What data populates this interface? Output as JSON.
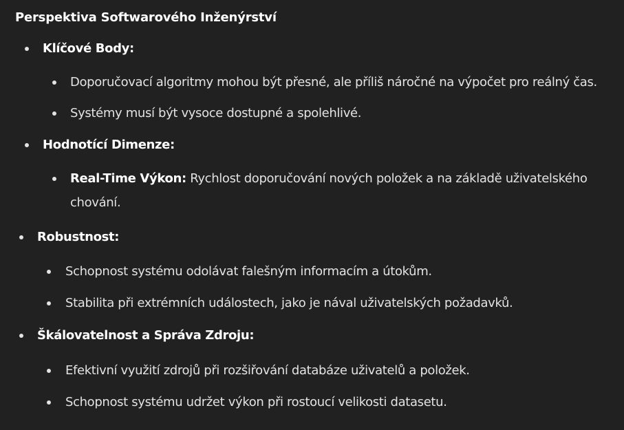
{
  "heading": "Perspektiva Softwarového Inženýrství",
  "sections": {
    "key_points": {
      "title": "Klíčové Body:",
      "items": [
        "Doporučovací algoritmy mohou být přesné, ale příliš náročné na výpočet pro reálný čas.",
        "Systémy musí být vysoce dostupné a spolehlivé."
      ]
    },
    "eval_dimensions": {
      "title": "Hodnotící Dimenze:",
      "items": [
        {
          "bold": "Real-Time Výkon:",
          "text": " Rychlost doporučování nových položek a na základě uživatelského chování."
        }
      ]
    },
    "robustness": {
      "title": "Robustnost:",
      "items": [
        "Schopnost systému odolávat falešným informacím a útokům.",
        "Stabilita při extrémních událostech, jako je nával uživatelských požadavků."
      ]
    },
    "scalability": {
      "title": "Škálovatelnost a Správa Zdroju:",
      "items": [
        "Efektivní využití zdrojů při rozšiřování databáze uživatelů a položek.",
        "Schopnost systému udržet výkon při rostoucí velikosti datasetu."
      ]
    }
  }
}
